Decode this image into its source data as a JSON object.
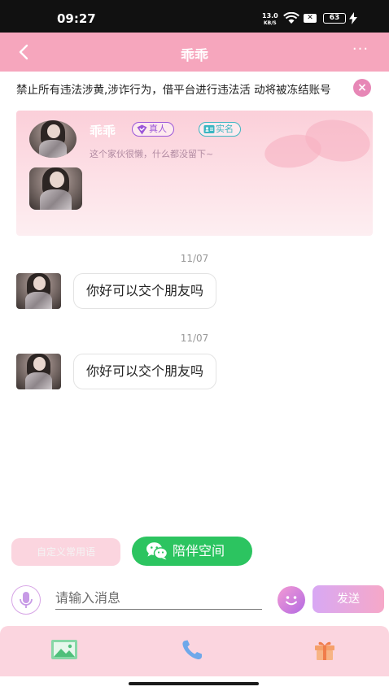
{
  "status_bar": {
    "time": "09:27",
    "network_speed_value": "13.0",
    "network_speed_unit": "KB/S",
    "battery": "63"
  },
  "header": {
    "title": "乖乖",
    "back_icon": "chevron-left-icon",
    "more_icon": "more-dots-icon"
  },
  "notice": {
    "text": "禁止所有违法涉黄,涉诈行为，借平台进行违法活 动将被冻结账号",
    "close_icon": "close-icon"
  },
  "profile": {
    "name": "乖乖",
    "badges": [
      "真人",
      "实名"
    ],
    "signature": "这个家伙很懒，什么都没留下~"
  },
  "messages": [
    {
      "date": "11/07",
      "text": "你好可以交个朋友吗"
    },
    {
      "date": "11/07",
      "text": "你好可以交个朋友吗"
    }
  ],
  "quick_actions": {
    "custom_phrases": "自定义常用语",
    "companion_space": "陪伴空间"
  },
  "composer": {
    "placeholder": "请输入消息",
    "send": "发送"
  },
  "toolbar": {
    "items": [
      "image-icon",
      "phone-icon",
      "gift-icon"
    ]
  },
  "colors": {
    "header_pink": "#f6a6bd",
    "accent_green": "#2cc460",
    "purple": "#9b56d8",
    "teal": "#3bb6c2"
  }
}
